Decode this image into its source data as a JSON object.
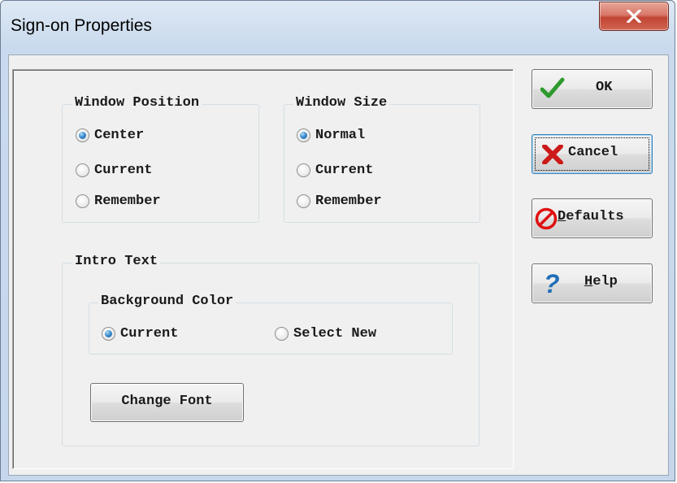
{
  "window": {
    "title": "Sign-on Properties",
    "close_icon": "close-icon"
  },
  "window_position": {
    "label": "Window Position",
    "options": [
      {
        "label": "Center",
        "checked": true
      },
      {
        "label": "Current",
        "checked": false
      },
      {
        "label": "Remember",
        "checked": false
      }
    ]
  },
  "window_size": {
    "label": "Window Size",
    "options": [
      {
        "label": "Normal",
        "checked": true
      },
      {
        "label": "Current",
        "checked": false
      },
      {
        "label": "Remember",
        "checked": false
      }
    ]
  },
  "intro_text": {
    "label": "Intro Text",
    "background_color": {
      "label": "Background Color",
      "options": [
        {
          "label": "Current",
          "checked": true
        },
        {
          "label": "Select New",
          "checked": false
        }
      ]
    },
    "change_font_label": "Change Font"
  },
  "buttons": {
    "ok": {
      "label": "OK",
      "icon": "checkmark-icon",
      "color": "#2e9a2e"
    },
    "cancel": {
      "label": "Cancel",
      "icon": "red-x-icon",
      "color": "#cc1a1a",
      "focused": true
    },
    "defaults": {
      "mnemonic": "D",
      "rest": "efaults",
      "icon": "no-entry-icon",
      "color": "#e01010"
    },
    "help": {
      "mnemonic": "H",
      "rest": "elp",
      "icon": "question-mark-icon",
      "color": "#1f6fb8"
    }
  }
}
